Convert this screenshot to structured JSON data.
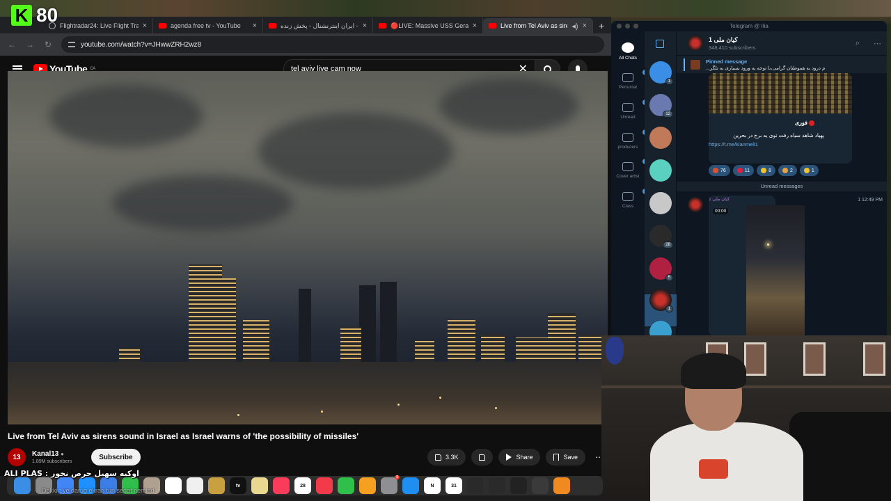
{
  "stream": {
    "viewer_count": "80",
    "chat_user": "ALI PLAS :",
    "chat_message": "اوکیه سهیل حرص نخور",
    "chat_line2": "Dokki : ye darug ekran tun sedat nemiad"
  },
  "browser": {
    "tabs": [
      {
        "label": "Flightradar24: Live Flight Tra",
        "icon": "globe-icon"
      },
      {
        "label": "agenda free tv - YouTube",
        "icon": "youtube-icon"
      },
      {
        "label": "ایران اینترنشنال - پخش زنده - ube",
        "icon": "youtube-icon"
      },
      {
        "label": "🔴LIVE: Massive USS Gerald",
        "icon": "youtube-icon"
      },
      {
        "label": "Live from Tel Aviv as siren",
        "icon": "youtube-icon",
        "active": true
      }
    ],
    "url": "youtube.com/watch?v=JHwwZRH2wz8"
  },
  "youtube": {
    "logo_text": "YouTube",
    "region": "CA",
    "search_value": "tel aviv live cam now",
    "video_title": "Live from Tel Aviv as sirens sound in Israel as Israel warns of 'the possibility of missiles'",
    "channel": {
      "name": "Kanal13",
      "subscribers": "1.89M subscribers",
      "avatar_text": "13"
    },
    "subscribe_label": "Subscribe",
    "likes": "3.3K",
    "share_label": "Share",
    "save_label": "Save"
  },
  "telegram": {
    "window_title": "Telegram @ Ilia",
    "folders": [
      {
        "label": "All Chats",
        "badge": ""
      },
      {
        "label": "Personal",
        "badge": "394"
      },
      {
        "label": "Unread",
        "badge": "536"
      },
      {
        "label": "producers",
        "badge": "3"
      },
      {
        "label": "Cover artist",
        "badge": "1"
      },
      {
        "label": "Class",
        "badge": "4"
      }
    ],
    "chat_badges": [
      "1",
      "12",
      "",
      "",
      "",
      "28",
      "5",
      "1",
      ""
    ],
    "channel_name": "کیان ملی 1",
    "channel_subs": "348,410 subscribers",
    "pinned_label": "Pinned message",
    "pinned_text": "م درود به هموطنان گرامی،با توجه به ورود بسیاری به تلگر...",
    "post_tag": "فوری",
    "post_text": "پهپاد شاهد سیاه رفت توی یه برج در بحرین",
    "post_link": "https://t.me/kianmeli1",
    "reactions": [
      {
        "count": "76",
        "color": "#e0502a"
      },
      {
        "count": "11",
        "color": "#e02040"
      },
      {
        "count": "8",
        "color": "#f2c12e"
      },
      {
        "count": "2",
        "color": "#e8a040"
      },
      {
        "count": "1",
        "color": "#f2c12e"
      }
    ],
    "unread_label": "Unread messages",
    "msg2_author": "کیان ملی 1",
    "msg2_duration": "00:00",
    "msg2_time": "1 12:49 PM"
  },
  "dock": {
    "items": [
      {
        "name": "finder-icon",
        "color": "#3a8ee6",
        "label": ""
      },
      {
        "name": "launchpad-icon",
        "color": "#8a8a8a",
        "label": ""
      },
      {
        "name": "chrome-icon",
        "color": "#4285f4",
        "label": ""
      },
      {
        "name": "safari-icon",
        "color": "#1e90ff",
        "label": ""
      },
      {
        "name": "mail-icon",
        "color": "#3a7ee6",
        "label": ""
      },
      {
        "name": "facetime-icon",
        "color": "#2fbf4a",
        "label": ""
      },
      {
        "name": "contacts-icon",
        "color": "#b0a090",
        "label": ""
      },
      {
        "name": "calendar-icon",
        "color": "#ffffff",
        "label": ""
      },
      {
        "name": "freeform-icon",
        "color": "#f0f0f0",
        "label": ""
      },
      {
        "name": "keynote-icon",
        "color": "#c8a040",
        "label": ""
      },
      {
        "name": "appletv-icon",
        "color": "#111111",
        "label": "tv"
      },
      {
        "name": "notes-icon",
        "color": "#e8d890",
        "label": ""
      },
      {
        "name": "music-icon",
        "color": "#fa3c5a",
        "label": ""
      },
      {
        "name": "calendar-date-icon",
        "color": "#ffffff",
        "label": "28"
      },
      {
        "name": "news-icon",
        "color": "#f23a4a",
        "label": ""
      },
      {
        "name": "numbers-icon",
        "color": "#2fbf4a",
        "label": ""
      },
      {
        "name": "pages-icon",
        "color": "#f5a020",
        "label": ""
      },
      {
        "name": "settings-icon",
        "color": "#8e8e93",
        "label": ""
      },
      {
        "name": "appstore-icon",
        "color": "#1e8ef0",
        "label": ""
      },
      {
        "name": "notion-icon",
        "color": "#ffffff",
        "label": "N"
      },
      {
        "name": "calendar31-icon",
        "color": "#ffffff",
        "label": "31"
      },
      {
        "name": "instruments-icon",
        "color": "#2a2a2a",
        "label": ""
      },
      {
        "name": "audio-midi-icon",
        "color": "#2a2a2a",
        "label": ""
      },
      {
        "name": "unity-icon",
        "color": "#222222",
        "label": ""
      },
      {
        "name": "obs-icon",
        "color": "#3a3a3a",
        "label": ""
      },
      {
        "name": "fl-studio-icon",
        "color": "#f08a20",
        "label": ""
      }
    ],
    "badge": "5"
  }
}
